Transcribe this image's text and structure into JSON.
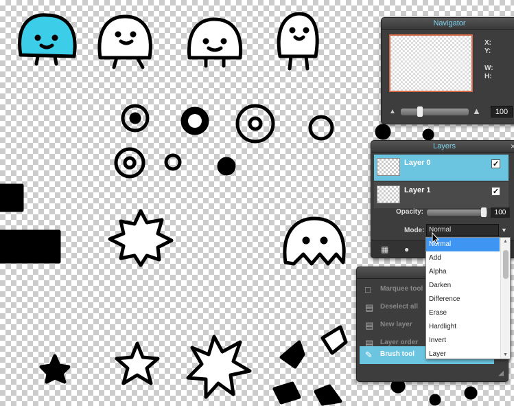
{
  "colors": {
    "accent": "#6bc5e0",
    "title": "#7fd4ef",
    "panel": "#3d3d3d",
    "dropdown_selected": "#3f95f2",
    "doodle_fill": "#3ccde8"
  },
  "navigator": {
    "title": "Navigator",
    "x_label": "X:",
    "y_label": "Y:",
    "w_label": "W:",
    "h_label": "H:",
    "zoom_value": "100"
  },
  "layers": {
    "title": "Layers",
    "items": [
      {
        "name": "Layer 0",
        "visible": true,
        "selected": true
      },
      {
        "name": "Layer 1",
        "visible": true,
        "selected": false
      }
    ],
    "opacity_label": "Opacity:",
    "opacity_value": "100",
    "mode_label": "Mode:",
    "mode_value": "Normal"
  },
  "history": {
    "title": "H",
    "items": [
      {
        "label": "Marquee tool",
        "icon": "marquee-icon"
      },
      {
        "label": "Deselect all",
        "icon": "deselect-icon"
      },
      {
        "label": "New layer",
        "icon": "new-layer-icon"
      },
      {
        "label": "Layer order",
        "icon": "layer-order-icon"
      },
      {
        "label": "Brush tool",
        "icon": "brush-icon",
        "active": true
      }
    ]
  },
  "mode_dropdown": {
    "options": [
      "Normal",
      "Add",
      "Alpha",
      "Darken",
      "Difference",
      "Erase",
      "Hardlight",
      "Invert",
      "Layer"
    ],
    "selected": "Normal"
  }
}
